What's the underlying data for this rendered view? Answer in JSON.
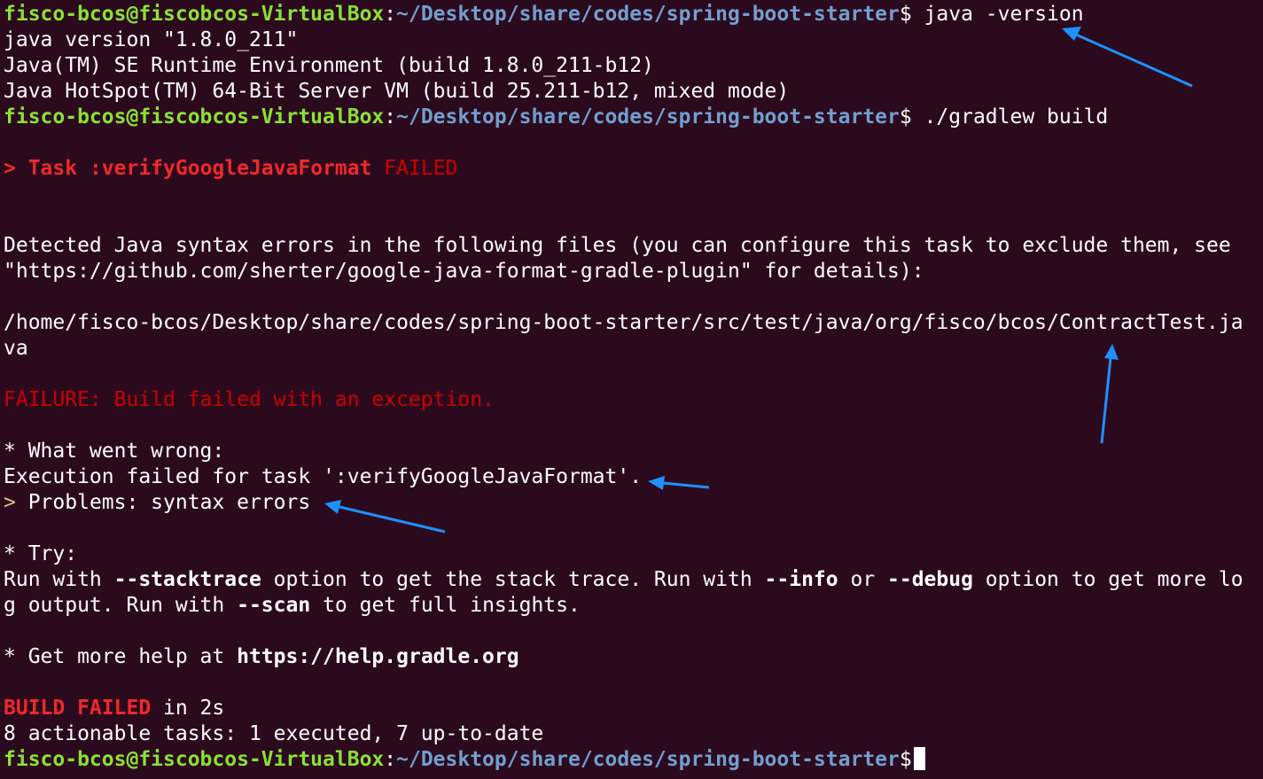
{
  "prompt": {
    "user_host": "fisco-bcos@fiscobcos-VirtualBox",
    "colon": ":",
    "path": "~/Desktop/share/codes/spring-boot-starter",
    "symbol": "$"
  },
  "commands": {
    "java_version": " java -version",
    "gradlew_build": " ./gradlew build",
    "last": ""
  },
  "output": {
    "java1": "java version \"1.8.0_211\"",
    "java2": "Java(TM) SE Runtime Environment (build 1.8.0_211-b12)",
    "java3": "Java HotSpot(TM) 64-Bit Server VM (build 25.211-b12, mixed mode)",
    "task_arrow": ">",
    "task_label": " Task :verifyGoogleJavaFormat",
    "task_status": " FAILED",
    "detected1": "Detected Java syntax errors in the following files (you can configure this task to exclude them, see",
    "detected2": "\"https://github.com/sherter/google-java-format-gradle-plugin\" for details):",
    "file1": "/home/fisco-bcos/Desktop/share/codes/spring-boot-starter/src/test/java/org/fisco/bcos/ContractTest.ja",
    "file2": "va",
    "failure": "FAILURE: Build failed with an exception.",
    "wrong_header": "* What went wrong:",
    "wrong_detail": "Execution failed for task ':verifyGoogleJavaFormat'.",
    "problems_arrow": ">",
    "problems_text": " Problems: syntax errors",
    "try_header": "* Try:",
    "run1_a": "Run with ",
    "run1_b": "--stacktrace",
    "run1_c": " option to get the stack trace. Run with ",
    "run1_d": "--info",
    "run1_e": " or ",
    "run1_f": "--debug",
    "run1_g": " option to get more lo",
    "run2_a": "g output. Run with ",
    "run2_b": "--scan",
    "run2_c": " to get full insights.",
    "help_a": "* Get more help at ",
    "help_b": "https://help.gradle.org",
    "build_failed": "BUILD FAILED",
    "build_time": " in 2s",
    "actionable": "8 actionable tasks: 1 executed, 7 up-to-date"
  },
  "colors": {
    "background": "#2c0a1e",
    "prompt_user": "#8ae234",
    "prompt_path": "#729fcf",
    "error_red": "#ef2929",
    "annotation_arrow": "#1e90ff"
  }
}
